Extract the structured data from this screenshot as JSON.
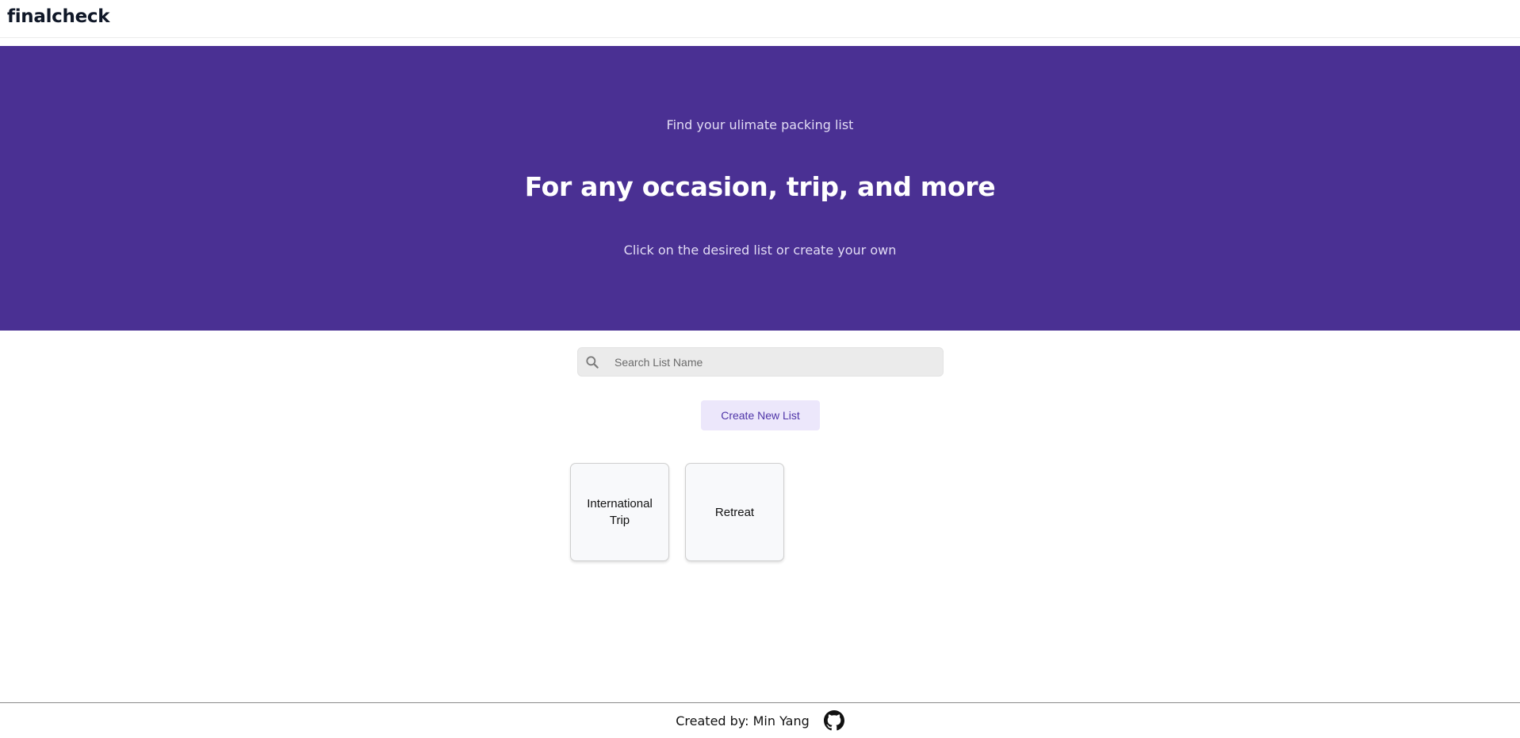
{
  "header": {
    "brand": "finalcheck"
  },
  "hero": {
    "eyebrow": "Find your ulimate packing list",
    "title": "For any occasion, trip, and more",
    "subtitle": "Click on the desired list or create your own",
    "background_color": "#4a3093"
  },
  "search": {
    "placeholder": "Search List Name",
    "value": "",
    "icon": "search-icon"
  },
  "actions": {
    "create_label": "Create New List"
  },
  "lists": [
    {
      "label": "International Trip"
    },
    {
      "label": "Retreat"
    }
  ],
  "footer": {
    "credit": "Created by: Min Yang",
    "icon": "github-icon"
  },
  "colors": {
    "accent": "#4f35a8",
    "button_bg": "#ece7fb"
  }
}
